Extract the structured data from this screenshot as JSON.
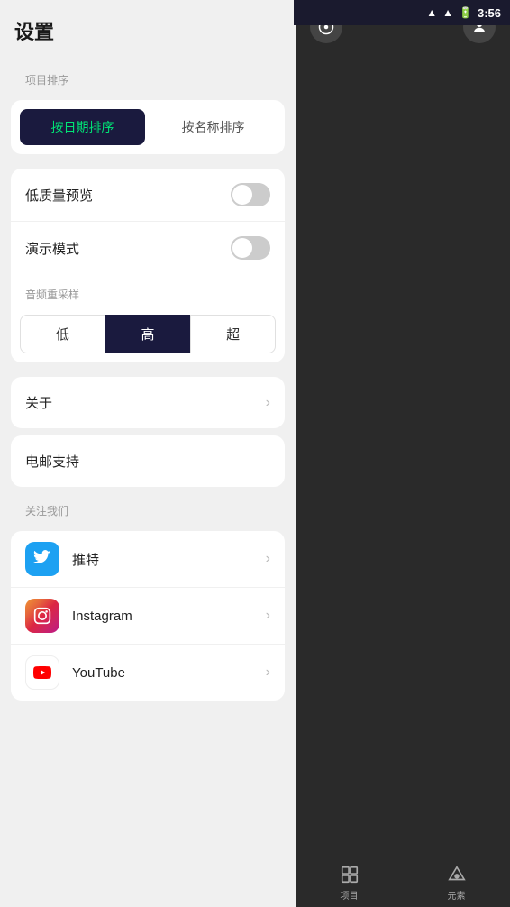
{
  "statusBar": {
    "time": "3:56"
  },
  "settings": {
    "title": "设置",
    "sortSection": {
      "label": "项目排序",
      "byDateLabel": "按日期排序",
      "byNameLabel": "按名称排序",
      "activeIndex": 0
    },
    "toggleSection": {
      "lowQualityPreview": {
        "label": "低质量预览",
        "enabled": false
      },
      "demoMode": {
        "label": "演示模式",
        "enabled": false
      }
    },
    "resampleSection": {
      "label": "音频重采样",
      "options": [
        "低",
        "高",
        "超"
      ],
      "activeIndex": 1
    },
    "aboutItem": {
      "label": "关于"
    },
    "emailItem": {
      "label": "电邮支持"
    },
    "followSection": {
      "label": "关注我们",
      "items": [
        {
          "name": "推特",
          "platform": "twitter"
        },
        {
          "name": "Instagram",
          "platform": "instagram"
        },
        {
          "name": "YouTube",
          "platform": "youtube"
        }
      ]
    }
  },
  "bottomNav": {
    "items": [
      {
        "label": "项目",
        "icon": "grid"
      },
      {
        "label": "元素",
        "icon": "layers"
      }
    ]
  }
}
